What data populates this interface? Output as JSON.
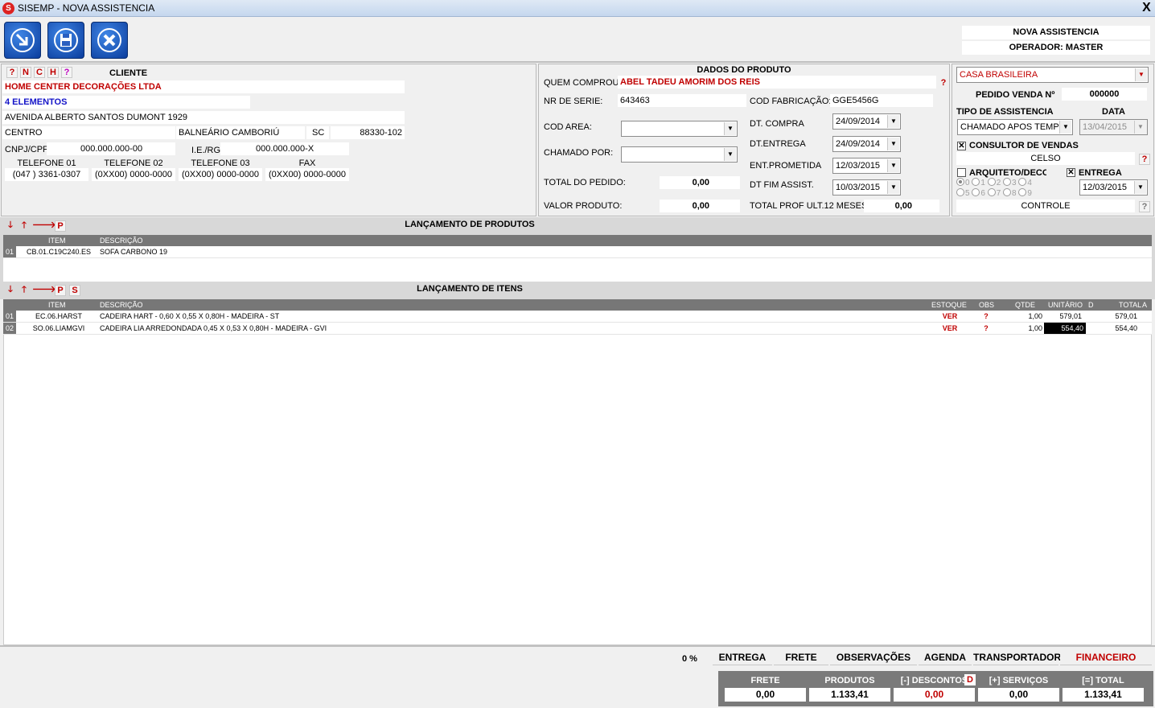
{
  "window": {
    "title": "SISEMP - NOVA ASSISTENCIA",
    "close": "X"
  },
  "header": {
    "mode": "NOVA ASSISTENCIA",
    "operator": "OPERADOR: MASTER"
  },
  "cliente": {
    "heading": "CLIENTE",
    "buttons": [
      "?",
      "N",
      "C",
      "H",
      "?"
    ],
    "name": "HOME CENTER DECORAÇÕES LTDA",
    "fantasy": "4 ELEMENTOS",
    "address": "AVENIDA ALBERTO SANTOS DUMONT 1929",
    "district": "CENTRO",
    "city": "BALNEÁRIO CAMBORIÚ",
    "state": "SC",
    "zip": "88330-102",
    "cnpj_label": "CNPJ/CPF",
    "cnpj": "000.000.000-00",
    "ie_label": "I.E./RG",
    "ie": "000.000.000-X",
    "phones": [
      {
        "label": "TELEFONE 01",
        "value": "(047  ) 3361-0307"
      },
      {
        "label": "TELEFONE 02",
        "value": "(0XX00) 0000-0000"
      },
      {
        "label": "TELEFONE 03",
        "value": "(0XX00) 0000-0000"
      },
      {
        "label": "FAX",
        "value": "(0XX00) 0000-0000"
      }
    ]
  },
  "produto": {
    "heading": "DADOS DO PRODUTO",
    "quem_label": "QUEM COMPROU:",
    "quem": "ABEL TADEU AMORIM DOS REIS",
    "serie_label": "NR DE SERIE:",
    "serie": "643463",
    "fab_label": "COD FABRICAÇÃO:",
    "fab": "GGE5456G",
    "area_label": "COD AREA:",
    "area": "",
    "chamado_label": "CHAMADO POR:",
    "chamado": "",
    "compra_label": "DT. COMPRA",
    "compra": "24/09/2014",
    "entrega_label": "DT.ENTREGA",
    "entrega": "24/09/2014",
    "prometida_label": "ENT.PROMETIDA",
    "prometida": "12/03/2015",
    "fim_label": "DT FIM ASSIST.",
    "fim": "10/03/2015",
    "total_pedido_label": "TOTAL DO PEDIDO:",
    "total_pedido": "0,00",
    "valor_label": "VALOR PRODUTO:",
    "valor": "0,00",
    "total_prof_label": "TOTAL PROF ULT.12 MESES:",
    "total_prof": "0,00",
    "help": "?"
  },
  "loja": {
    "store": "CASA BRASILEIRA",
    "pedido_label": "PEDIDO VENDA Nº",
    "pedido": "000000",
    "tipo_label": "TIPO DE ASSISTENCIA",
    "data_label": "DATA",
    "tipo": "CHAMADO APOS TEMPO",
    "data": "13/04/2015",
    "consultor_label": "CONSULTOR DE VENDAS",
    "consultor": "CELSO",
    "arquiteto_label": "ARQUITETO/DECOI",
    "entrega_label": "ENTREGA",
    "entrega": "12/03/2015",
    "radios": [
      "0",
      "1",
      "2",
      "3",
      "4",
      "5",
      "6",
      "7",
      "8",
      "9"
    ],
    "controle": "CONTROLE",
    "help1": "?",
    "help2": "?"
  },
  "produtos_grid": {
    "title": "LANÇAMENTO DE PRODUTOS",
    "p_btn": "P",
    "col_item": "ITEM",
    "col_desc": "DESCRIÇÃO",
    "rows": [
      {
        "n": "01",
        "item": "CB.01.C19C240.ES",
        "desc": "SOFA CARBONO 19"
      }
    ]
  },
  "itens_grid": {
    "title": "LANÇAMENTO DE ITENS",
    "p_btn": "P",
    "s_btn": "S",
    "cols": {
      "item": "ITEM",
      "desc": "DESCRIÇÃO",
      "estoque": "ESTOQUE",
      "obs": "OBS",
      "qtde": "QTDE",
      "unit": "UNITÁRIO",
      "d": "D",
      "total": "TOTAL",
      "a": "A"
    },
    "rows": [
      {
        "n": "01",
        "item": "EC.06.HARST",
        "desc": "CADEIRA HART - 0,60 X 0,55 X 0,80H - MADEIRA - ST",
        "estoque": "VER",
        "obs": "?",
        "qtde": "1,00",
        "unit": "579,01",
        "total": "579,01"
      },
      {
        "n": "02",
        "item": "SO.06.LIAMGVI",
        "desc": "CADEIRA LIA ARREDONDADA 0,45 X 0,53 X 0,80H - MADEIRA - GVI",
        "estoque": "VER",
        "obs": "?",
        "qtde": "1,00",
        "unit": "554,40",
        "total": "554,40"
      }
    ]
  },
  "footer": {
    "percent": "0 %",
    "tabs": [
      "ENTREGA",
      "FRETE",
      "OBSERVAÇÕES",
      "AGENDA",
      "TRANSPORTADORA",
      "FINANCEIRO"
    ],
    "totals": {
      "frete_label": "FRETE",
      "frete": "0,00",
      "produtos_label": "PRODUTOS",
      "produtos": "1.133,41",
      "descontos_label": "[-] DESCONTOS",
      "descontos": "0,00",
      "d_btn": "D",
      "servicos_label": "[+] SERVIÇOS",
      "servicos": "0,00",
      "total_label": "[=] TOTAL",
      "total": "1.133,41"
    }
  }
}
